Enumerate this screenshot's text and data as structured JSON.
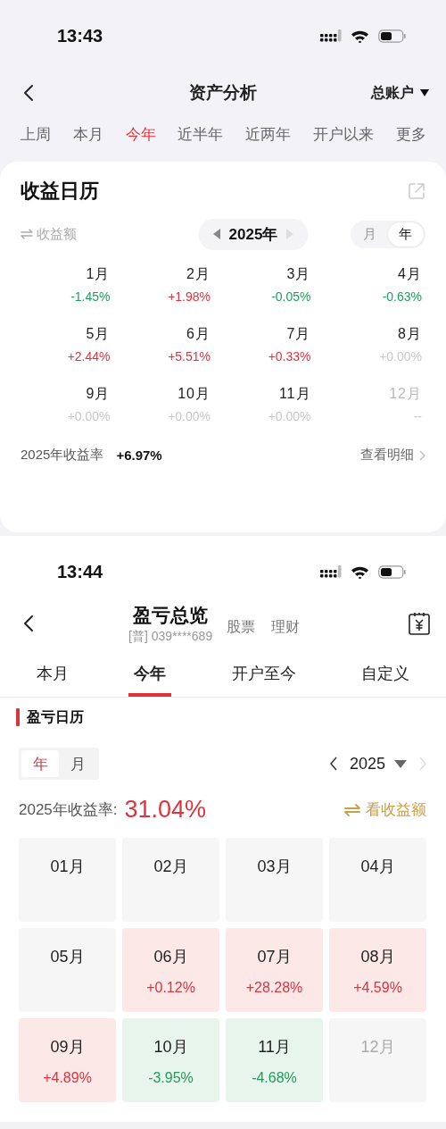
{
  "asset_analysis": {
    "status_bar": {
      "time": "13:43"
    },
    "nav": {
      "title": "资产分析",
      "account": "总账户"
    },
    "tabs": [
      {
        "label": "上周",
        "selected": false
      },
      {
        "label": "本月",
        "selected": false
      },
      {
        "label": "今年",
        "selected": true
      },
      {
        "label": "近半年",
        "selected": false
      },
      {
        "label": "近两年",
        "selected": false
      },
      {
        "label": "开户以来",
        "selected": false
      },
      {
        "label": "更多",
        "selected": false
      }
    ],
    "card": {
      "title": "收益日历",
      "metric_toggle": "收益额",
      "year": "2025年",
      "view_tabs": [
        {
          "label": "月",
          "selected": false
        },
        {
          "label": "年",
          "selected": true
        }
      ],
      "months": [
        {
          "label": "1月",
          "value": "-1.45%",
          "kind": "loss",
          "future": false
        },
        {
          "label": "2月",
          "value": "+1.98%",
          "kind": "gain",
          "future": false
        },
        {
          "label": "3月",
          "value": "-0.05%",
          "kind": "loss",
          "future": false
        },
        {
          "label": "4月",
          "value": "-0.63%",
          "kind": "loss",
          "future": false
        },
        {
          "label": "5月",
          "value": "+2.44%",
          "kind": "gain",
          "future": false
        },
        {
          "label": "6月",
          "value": "+5.51%",
          "kind": "gain",
          "future": false
        },
        {
          "label": "7月",
          "value": "+0.33%",
          "kind": "gain",
          "future": false
        },
        {
          "label": "8月",
          "value": "+0.00%",
          "kind": "flat",
          "future": false
        },
        {
          "label": "9月",
          "value": "+0.00%",
          "kind": "flat",
          "future": false
        },
        {
          "label": "10月",
          "value": "+0.00%",
          "kind": "flat",
          "future": false
        },
        {
          "label": "11月",
          "value": "+0.00%",
          "kind": "flat",
          "future": false
        },
        {
          "label": "12月",
          "value": "--",
          "kind": "flat",
          "future": true
        }
      ],
      "summary_label": "2025年收益率",
      "summary_value": "+6.97%",
      "detail_link": "查看明细"
    }
  },
  "profit_overview": {
    "status_bar": {
      "time": "13:44"
    },
    "nav": {
      "title": "盈亏总览",
      "account": "[普] 039****689",
      "links": [
        "股票",
        "理财"
      ]
    },
    "tabs": [
      {
        "label": "本月",
        "selected": false
      },
      {
        "label": "今年",
        "selected": true
      },
      {
        "label": "开户至今",
        "selected": false
      },
      {
        "label": "自定义",
        "selected": false
      }
    ],
    "section_title": "盈亏日历",
    "view_tabs": [
      {
        "label": "年",
        "selected": true
      },
      {
        "label": "月",
        "selected": false
      }
    ],
    "year": "2025",
    "next_disabled": true,
    "rate_label": "2025年收益率:",
    "rate_value": "31.04%",
    "toggle_label": "看收益额",
    "months": [
      {
        "label": "01月",
        "kind": "empty",
        "future": false
      },
      {
        "label": "02月",
        "kind": "empty",
        "future": false
      },
      {
        "label": "03月",
        "kind": "empty",
        "future": false
      },
      {
        "label": "04月",
        "kind": "empty",
        "future": false
      },
      {
        "label": "05月",
        "kind": "empty",
        "future": false
      },
      {
        "label": "06月",
        "value": "+0.12%",
        "kind": "gain",
        "future": false
      },
      {
        "label": "07月",
        "value": "+28.28%",
        "kind": "gain",
        "future": false
      },
      {
        "label": "08月",
        "value": "+4.59%",
        "kind": "gain",
        "future": false
      },
      {
        "label": "09月",
        "value": "+4.89%",
        "kind": "gain",
        "future": false
      },
      {
        "label": "10月",
        "value": "-3.95%",
        "kind": "loss",
        "future": false
      },
      {
        "label": "11月",
        "value": "-4.68%",
        "kind": "loss",
        "future": false
      },
      {
        "label": "12月",
        "kind": "empty",
        "future": true
      }
    ]
  }
}
